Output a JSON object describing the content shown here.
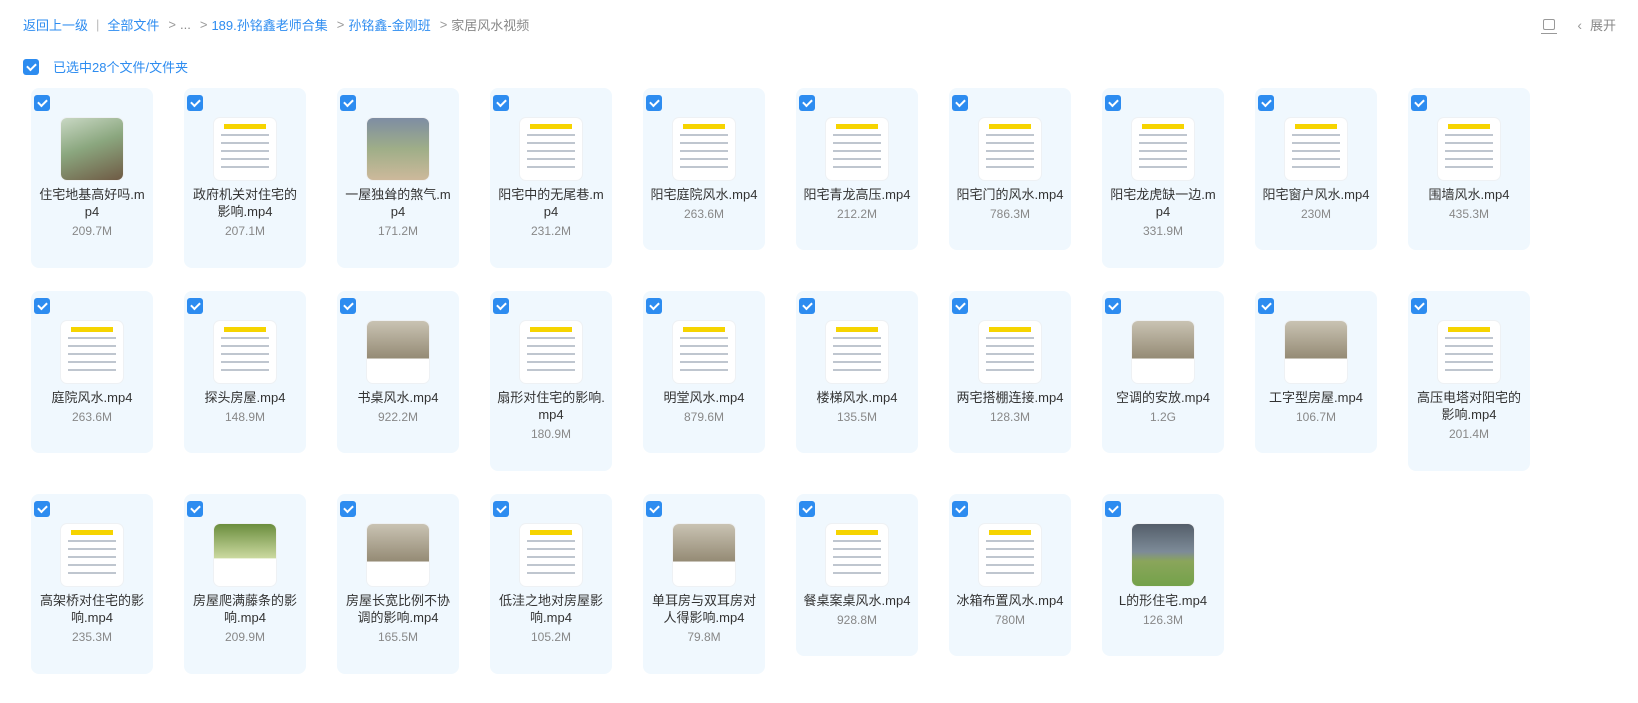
{
  "breadcrumb": {
    "back": "返回上一级",
    "all_files": "全部文件",
    "ellipsis": "...",
    "items": [
      "189.孙铭鑫老师合集",
      "孙铭鑫-金刚班"
    ],
    "current": "家居风水视频"
  },
  "toolbar": {
    "expand_label": "展开",
    "list_icon": "list-view-icon",
    "chevron_icon": "chevron-left-icon"
  },
  "selection": {
    "label": "已选中28个文件/文件夹",
    "checked": true
  },
  "colors": {
    "accent": "#2d8cf0",
    "card_bg": "#f0f8fe"
  },
  "files": [
    {
      "name": "住宅地基高好吗.mp4",
      "size": "209.7M",
      "thumb": "photo"
    },
    {
      "name": "政府机关对住宅的影响.mp4",
      "size": "207.1M",
      "thumb": "doc"
    },
    {
      "name": "一屋独耸的煞气.mp4",
      "size": "171.2M",
      "thumb": "photo2"
    },
    {
      "name": "阳宅中的无尾巷.mp4",
      "size": "231.2M",
      "thumb": "doc"
    },
    {
      "name": "阳宅庭院风水.mp4",
      "size": "263.6M",
      "thumb": "doc"
    },
    {
      "name": "阳宅青龙高压.mp4",
      "size": "212.2M",
      "thumb": "doc"
    },
    {
      "name": "阳宅门的风水.mp4",
      "size": "786.3M",
      "thumb": "doc"
    },
    {
      "name": "阳宅龙虎缺一边.mp4",
      "size": "331.9M",
      "thumb": "doc"
    },
    {
      "name": "阳宅窗户风水.mp4",
      "size": "230M",
      "thumb": "doc"
    },
    {
      "name": "围墙风水.mp4",
      "size": "435.3M",
      "thumb": "doc"
    },
    {
      "name": "庭院风水.mp4",
      "size": "263.6M",
      "thumb": "doc"
    },
    {
      "name": "探头房屋.mp4",
      "size": "148.9M",
      "thumb": "doc"
    },
    {
      "name": "书桌风水.mp4",
      "size": "922.2M",
      "thumb": "photo4"
    },
    {
      "name": "扇形对住宅的影响.mp4",
      "size": "180.9M",
      "thumb": "doc"
    },
    {
      "name": "明堂风水.mp4",
      "size": "879.6M",
      "thumb": "doc"
    },
    {
      "name": "楼梯风水.mp4",
      "size": "135.5M",
      "thumb": "doc"
    },
    {
      "name": "两宅搭棚连接.mp4",
      "size": "128.3M",
      "thumb": "doc"
    },
    {
      "name": "空调的安放.mp4",
      "size": "1.2G",
      "thumb": "photo4"
    },
    {
      "name": "工字型房屋.mp4",
      "size": "106.7M",
      "thumb": "photo4"
    },
    {
      "name": "高压电塔对阳宅的影响.mp4",
      "size": "201.4M",
      "thumb": "doc"
    },
    {
      "name": "高架桥对住宅的影响.mp4",
      "size": "235.3M",
      "thumb": "doc"
    },
    {
      "name": "房屋爬满藤条的影响.mp4",
      "size": "209.9M",
      "thumb": "photo3"
    },
    {
      "name": "房屋长宽比例不协调的影响.mp4",
      "size": "165.5M",
      "thumb": "photo4"
    },
    {
      "name": "低洼之地对房屋影响.mp4",
      "size": "105.2M",
      "thumb": "doc"
    },
    {
      "name": "单耳房与双耳房对人得影响.mp4",
      "size": "79.8M",
      "thumb": "photo4"
    },
    {
      "name": "餐桌案桌风水.mp4",
      "size": "928.8M",
      "thumb": "doc"
    },
    {
      "name": "冰箱布置风水.mp4",
      "size": "780M",
      "thumb": "doc"
    },
    {
      "name": "L的形住宅.mp4",
      "size": "126.3M",
      "thumb": "photo5"
    }
  ]
}
